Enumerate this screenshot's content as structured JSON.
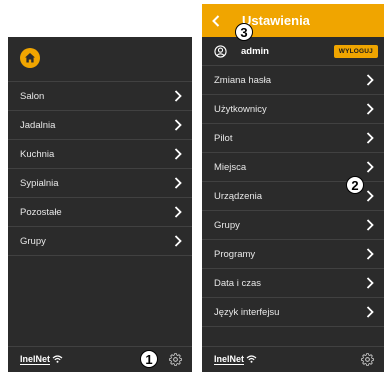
{
  "left_panel": {
    "items": [
      {
        "label": "Salon"
      },
      {
        "label": "Jadalnia"
      },
      {
        "label": "Kuchnia"
      },
      {
        "label": "Sypialnia"
      },
      {
        "label": "Pozostałe"
      },
      {
        "label": "Grupy"
      }
    ],
    "footer": {
      "logo_text": "InelNet"
    }
  },
  "right_panel": {
    "header": {
      "title": "Ustawienia"
    },
    "user": {
      "name": "admin",
      "logout_label": "WYLOGUJ"
    },
    "items": [
      {
        "label": "Zmiana hasła"
      },
      {
        "label": "Użytkownicy"
      },
      {
        "label": "Pilot"
      },
      {
        "label": "Miejsca"
      },
      {
        "label": "Urządzenia"
      },
      {
        "label": "Grupy"
      },
      {
        "label": "Programy"
      },
      {
        "label": "Data i czas"
      },
      {
        "label": "Język interfejsu"
      }
    ],
    "footer": {
      "logo_text": "InelNet"
    }
  },
  "callouts": {
    "one": "1",
    "two": "2",
    "three": "3"
  },
  "colors": {
    "accent": "#f0a500",
    "panel_bg": "#2b2b2b",
    "text": "#e8e8e8",
    "divider": "#414141"
  },
  "icons": {
    "home": "home-icon",
    "chevron": "chevron-right-icon",
    "back": "chevron-left-icon",
    "user": "user-icon",
    "settings": "gear-icon",
    "wifi": "wifi-icon"
  }
}
